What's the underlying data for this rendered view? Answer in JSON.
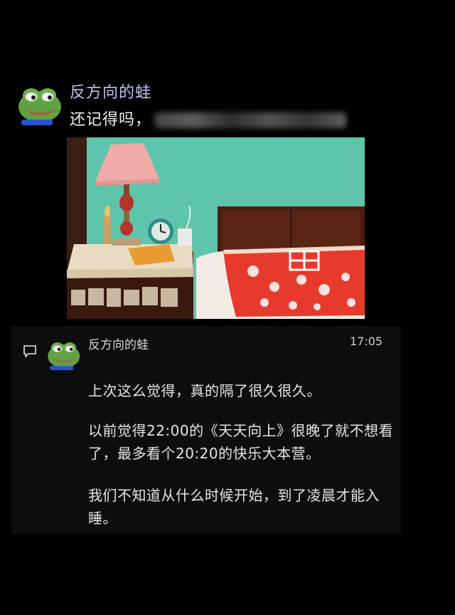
{
  "post": {
    "author": "反方向的蛙",
    "text": "还记得吗，",
    "avatar_icon": "pepe-frog-avatar",
    "redacted": true
  },
  "comment": {
    "icon": "comment-icon",
    "author": "反方向的蛙",
    "time": "17:05",
    "avatar_icon": "pepe-frog-avatar",
    "paragraphs": [
      "上次这么觉得，真的隔了很久很久。",
      "以前觉得22:00的《天天向上》很晚了就不想看了，最多看个20:20的快乐大本营。",
      "我们不知道从什么时候开始，到了凌晨才能入睡。"
    ]
  },
  "colors": {
    "background": "#000000",
    "author_name": "#b9c6ef",
    "card_bg": "#0d0d0f",
    "wall": "#5fc0a8",
    "blanket_red": "#e63a2c"
  }
}
